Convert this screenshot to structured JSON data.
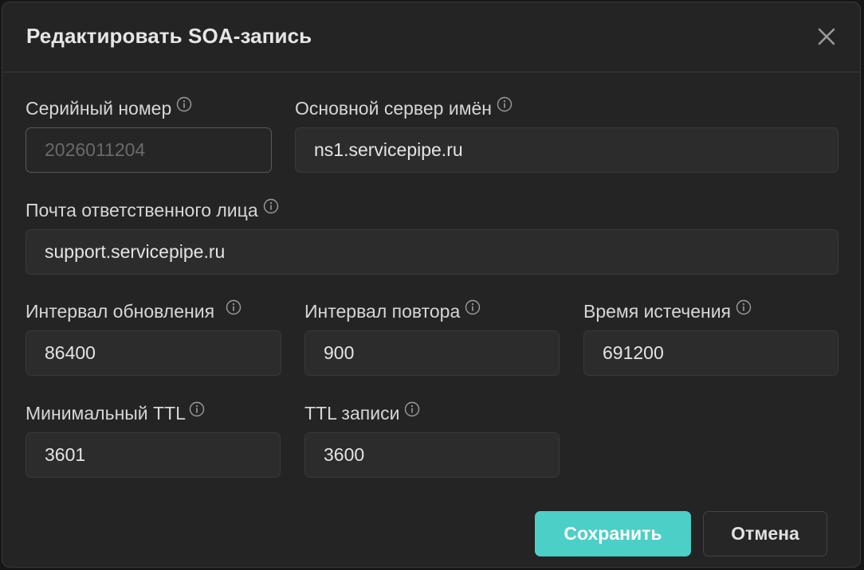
{
  "dialog": {
    "title": "Редактировать SOA-запись",
    "close_icon": "close-icon"
  },
  "fields": {
    "serial": {
      "label": "Серийный номер",
      "value": "2026011204",
      "disabled": true
    },
    "primary_ns": {
      "label": "Основной сервер имён",
      "value": "ns1.servicepipe.ru"
    },
    "email": {
      "label": "Почта ответственного лица",
      "value": "support.servicepipe.ru"
    },
    "refresh": {
      "label": "Интервал обновления",
      "value": "86400"
    },
    "retry": {
      "label": "Интервал повтора",
      "value": "900"
    },
    "expire": {
      "label": "Время истечения",
      "value": "691200"
    },
    "min_ttl": {
      "label": "Минимальный TTL",
      "value": "3601"
    },
    "record_ttl": {
      "label": "TTL записи",
      "value": "3600"
    }
  },
  "actions": {
    "save_label": "Сохранить",
    "cancel_label": "Отмена"
  },
  "colors": {
    "accent": "#4ccfc6",
    "dialog_bg": "#242424",
    "input_bg": "#2c2c2c"
  }
}
